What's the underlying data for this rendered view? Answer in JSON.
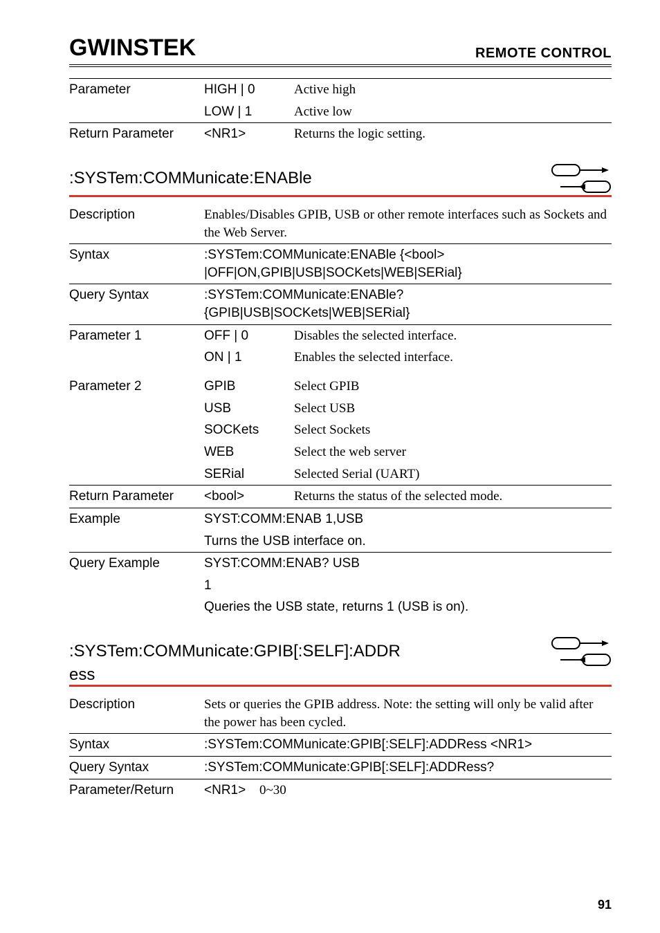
{
  "header": {
    "logo_text": "GWINSTEK",
    "title": "REMOTE CONTROL"
  },
  "block0": {
    "row0": {
      "label": "Parameter",
      "param": "HIGH | 0",
      "desc": "Active high"
    },
    "row1": {
      "label": "",
      "param": "LOW | 1",
      "desc": "Active low"
    },
    "row2": {
      "label": "Return Parameter",
      "param": "<NR1>",
      "desc": "Returns the logic setting."
    }
  },
  "section1": {
    "title": ":SYSTem:COMMunicate:ENABle",
    "rows": {
      "desc": {
        "label": "Description",
        "text": "Enables/Disables GPIB, USB or other remote interfaces such as Sockets and the Web Server."
      },
      "syntax": {
        "label": "Syntax",
        "text": ":SYSTem:COMMunicate:ENABle {<bool> |OFF|ON,GPIB|USB|SOCKets|WEB|SERial}"
      },
      "qsyntax": {
        "label": "Query Syntax",
        "text": ":SYSTem:COMMunicate:ENABle? {GPIB|USB|SOCKets|WEB|SERial}"
      },
      "p1a": {
        "label": "Parameter 1",
        "param": "OFF | 0",
        "desc": "Disables the selected interface."
      },
      "p1b": {
        "label": "",
        "param": "ON | 1",
        "desc": "Enables the selected interface."
      },
      "p2a": {
        "label": "Parameter 2",
        "param": "GPIB",
        "desc": "Select GPIB"
      },
      "p2b": {
        "label": "",
        "param": "USB",
        "desc": "Select USB"
      },
      "p2c": {
        "label": "",
        "param": "SOCKets",
        "desc": "Select Sockets"
      },
      "p2d": {
        "label": "",
        "param": "WEB",
        "desc": "Select the web server"
      },
      "p2e": {
        "label": "",
        "param": "SERial",
        "desc": "Selected Serial (UART)"
      },
      "ret": {
        "label": "Return Parameter",
        "param": "<bool>",
        "desc": "Returns the status of the selected mode."
      },
      "ex1": {
        "label": "Example",
        "text": "SYST:COMM:ENAB 1,USB"
      },
      "ex2": {
        "label": "",
        "text": "Turns the USB interface on."
      },
      "qex1": {
        "label": "Query Example",
        "text": "SYST:COMM:ENAB? USB"
      },
      "qex2": {
        "label": "",
        "text": "1"
      },
      "qex3": {
        "label": "",
        "text": "Queries the USB state, returns 1 (USB is on)."
      }
    }
  },
  "section2": {
    "title_line1": ":SYSTem:COMMunicate:GPIB[:SELF]:ADDR",
    "title_line2": "ess",
    "rows": {
      "desc": {
        "label": "Description",
        "text": "Sets or queries the GPIB address. Note: the setting will only be valid after the power has been cycled."
      },
      "syntax": {
        "label": "Syntax",
        "text": ":SYSTem:COMMunicate:GPIB[:SELF]:ADDRess <NR1>"
      },
      "qsyntax": {
        "label": "Query Syntax",
        "text": ":SYSTem:COMMunicate:GPIB[:SELF]:ADDRess?"
      },
      "pret": {
        "label": "Parameter/Return",
        "param": "<NR1>",
        "desc": "0~30"
      }
    }
  },
  "page": "91"
}
